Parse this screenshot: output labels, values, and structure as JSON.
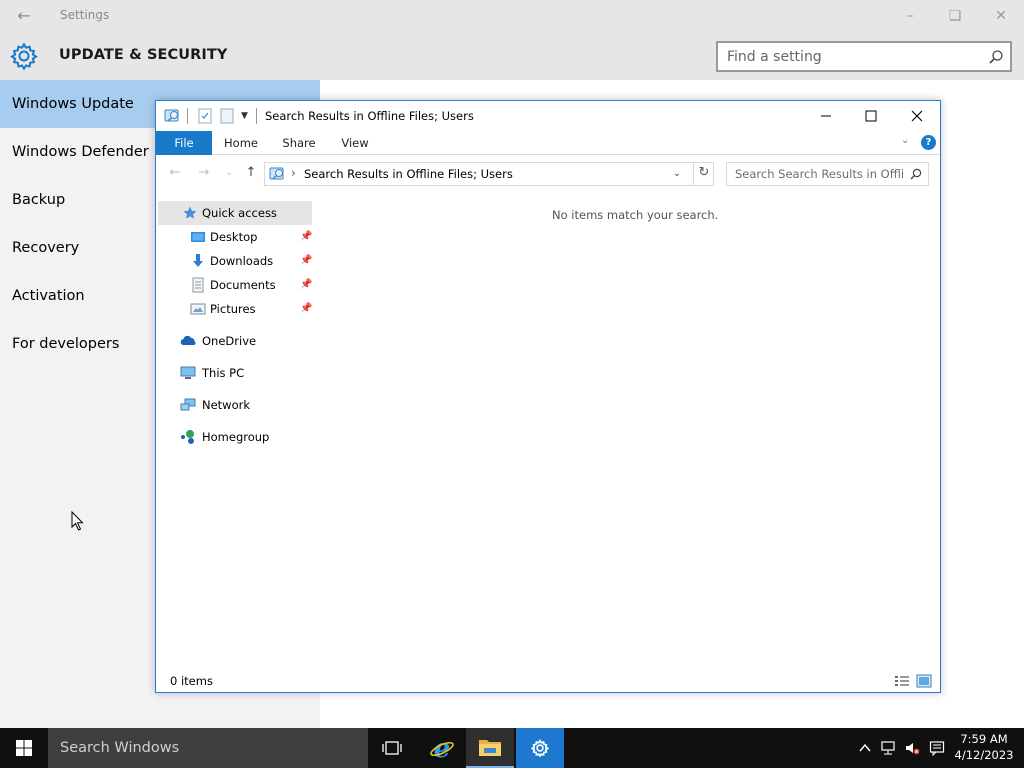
{
  "settings": {
    "window_title": "Settings",
    "heading": "UPDATE & SECURITY",
    "search_placeholder": "Find a setting",
    "nav_items": [
      {
        "label": "Windows Update",
        "active": true
      },
      {
        "label": "Windows Defender",
        "active": false
      },
      {
        "label": "Backup",
        "active": false
      },
      {
        "label": "Recovery",
        "active": false
      },
      {
        "label": "Activation",
        "active": false
      },
      {
        "label": "For developers",
        "active": false
      }
    ]
  },
  "explorer": {
    "title": "Search Results in Offline Files; Users",
    "ribbon_tabs": [
      "File",
      "Home",
      "Share",
      "View"
    ],
    "address": "Search Results in Offline Files; Users",
    "search_placeholder": "Search Search Results in Offli...",
    "nav_pane": {
      "quick_access": "Quick access",
      "pinned": [
        "Desktop",
        "Downloads",
        "Documents",
        "Pictures"
      ],
      "locations": [
        "OneDrive",
        "This PC",
        "Network",
        "Homegroup"
      ]
    },
    "empty_message": "No items match your search.",
    "status": "0 items"
  },
  "taskbar": {
    "search_placeholder": "Search Windows",
    "time": "7:59 AM",
    "date": "4/12/2023",
    "apps": [
      "task-view",
      "internet-explorer",
      "file-explorer",
      "settings"
    ]
  },
  "colors": {
    "accent": "#1979ca",
    "nav_selected": "#a6cdf0",
    "taskbar": "#101010"
  }
}
